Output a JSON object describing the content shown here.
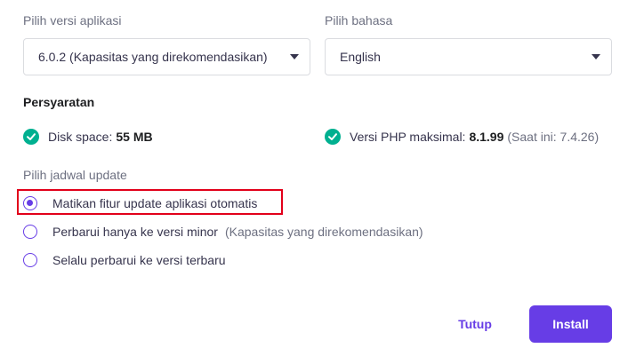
{
  "app_version": {
    "label": "Pilih versi aplikasi",
    "selected": "6.0.2 (Kapasitas yang direkomendasikan)"
  },
  "language": {
    "label": "Pilih bahasa",
    "selected": "English"
  },
  "requirements": {
    "title": "Persyaratan",
    "disk": {
      "label": "Disk space:",
      "value": "55 MB"
    },
    "php": {
      "label": "Versi PHP maksimal:",
      "value": "8.1.99",
      "current": "(Saat ini: 7.4.26)"
    }
  },
  "update_schedule": {
    "label": "Pilih jadwal update",
    "options": [
      {
        "label": "Matikan fitur update aplikasi otomatis",
        "note": "",
        "selected": true
      },
      {
        "label": "Perbarui hanya ke versi minor",
        "note": "(Kapasitas yang direkomendasikan)",
        "selected": false
      },
      {
        "label": "Selalu perbarui ke versi terbaru",
        "note": "",
        "selected": false
      }
    ]
  },
  "buttons": {
    "close": "Tutup",
    "install": "Install"
  },
  "colors": {
    "accent": "#673de6",
    "success": "#00b090",
    "highlight": "#e2001a"
  }
}
